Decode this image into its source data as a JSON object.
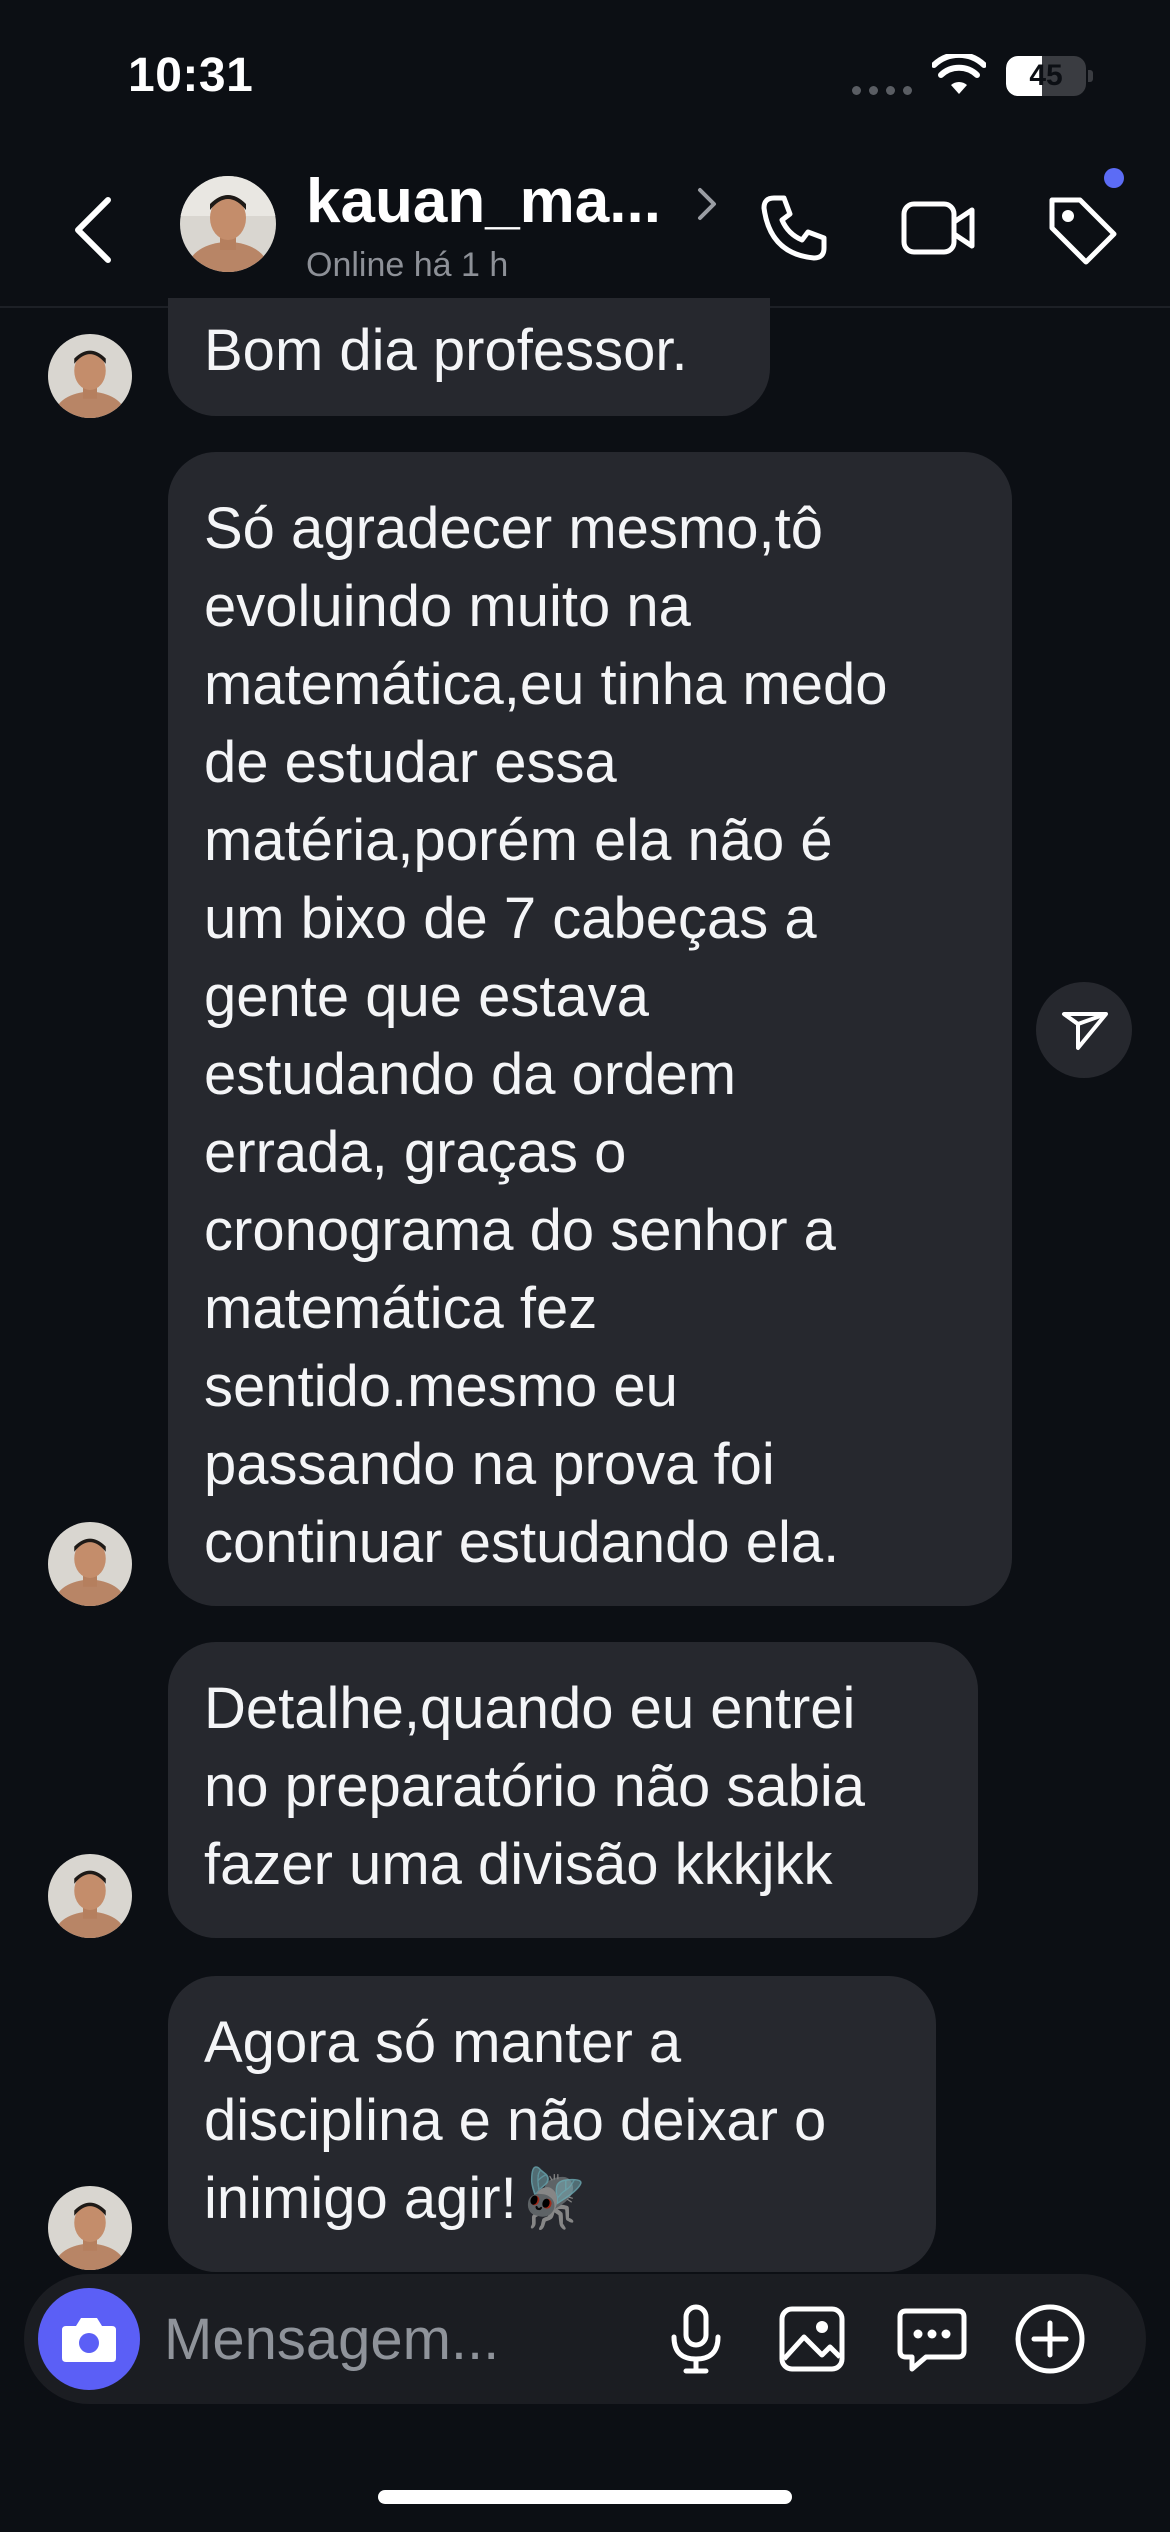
{
  "status_bar": {
    "time": "10:31",
    "battery_percent": "45",
    "battery_level": 0.45
  },
  "header": {
    "back_icon": "chevron-left-icon",
    "name": "kauan_ma...",
    "presence": "Online há 1 h",
    "call_icon": "phone-icon",
    "video_icon": "video-camera-icon",
    "label_icon": "tag-icon",
    "notification_dot_color": "#5c6cf5"
  },
  "messages": [
    {
      "lines": [
        "Bom dia professor."
      ]
    },
    {
      "lines": [
        "Só agradecer mesmo,tô",
        "evoluindo muito na",
        "matemática,eu tinha medo",
        "de estudar essa",
        "matéria,porém ela não é",
        "um bixo de 7 cabeças a",
        "gente que estava",
        "estudando da ordem",
        "errada, graças o",
        "cronograma do senhor a",
        "matemática fez",
        "sentido.mesmo eu",
        "passando na prova foi",
        "continuar estudando ela."
      ]
    },
    {
      "lines": [
        "Detalhe,quando eu entrei",
        "no preparatório não sabia",
        "fazer uma divisão kkkjkk"
      ]
    },
    {
      "lines": [
        "Agora só manter a",
        "disciplina e não deixar o",
        "inimigo agir!🪰"
      ]
    }
  ],
  "share_icon": "paper-plane-icon",
  "composer": {
    "placeholder": "Mensagem...",
    "camera_icon": "camera-icon",
    "mic_icon": "microphone-icon",
    "gallery_icon": "image-icon",
    "sticker_icon": "chat-bubble-icon",
    "plus_icon": "plus-circle-icon",
    "accent_color": "#5b5ff6"
  }
}
